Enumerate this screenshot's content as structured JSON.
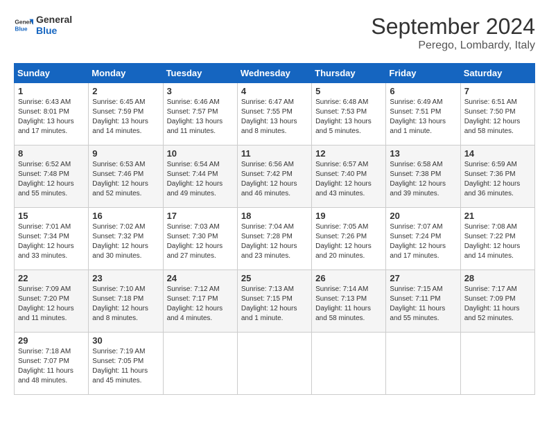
{
  "header": {
    "logo_line1": "General",
    "logo_line2": "Blue",
    "month": "September 2024",
    "location": "Perego, Lombardy, Italy"
  },
  "weekdays": [
    "Sunday",
    "Monday",
    "Tuesday",
    "Wednesday",
    "Thursday",
    "Friday",
    "Saturday"
  ],
  "weeks": [
    [
      {
        "day": "1",
        "lines": [
          "Sunrise: 6:43 AM",
          "Sunset: 8:01 PM",
          "Daylight: 13 hours",
          "and 17 minutes."
        ]
      },
      {
        "day": "2",
        "lines": [
          "Sunrise: 6:45 AM",
          "Sunset: 7:59 PM",
          "Daylight: 13 hours",
          "and 14 minutes."
        ]
      },
      {
        "day": "3",
        "lines": [
          "Sunrise: 6:46 AM",
          "Sunset: 7:57 PM",
          "Daylight: 13 hours",
          "and 11 minutes."
        ]
      },
      {
        "day": "4",
        "lines": [
          "Sunrise: 6:47 AM",
          "Sunset: 7:55 PM",
          "Daylight: 13 hours",
          "and 8 minutes."
        ]
      },
      {
        "day": "5",
        "lines": [
          "Sunrise: 6:48 AM",
          "Sunset: 7:53 PM",
          "Daylight: 13 hours",
          "and 5 minutes."
        ]
      },
      {
        "day": "6",
        "lines": [
          "Sunrise: 6:49 AM",
          "Sunset: 7:51 PM",
          "Daylight: 13 hours",
          "and 1 minute."
        ]
      },
      {
        "day": "7",
        "lines": [
          "Sunrise: 6:51 AM",
          "Sunset: 7:50 PM",
          "Daylight: 12 hours",
          "and 58 minutes."
        ]
      }
    ],
    [
      {
        "day": "8",
        "lines": [
          "Sunrise: 6:52 AM",
          "Sunset: 7:48 PM",
          "Daylight: 12 hours",
          "and 55 minutes."
        ]
      },
      {
        "day": "9",
        "lines": [
          "Sunrise: 6:53 AM",
          "Sunset: 7:46 PM",
          "Daylight: 12 hours",
          "and 52 minutes."
        ]
      },
      {
        "day": "10",
        "lines": [
          "Sunrise: 6:54 AM",
          "Sunset: 7:44 PM",
          "Daylight: 12 hours",
          "and 49 minutes."
        ]
      },
      {
        "day": "11",
        "lines": [
          "Sunrise: 6:56 AM",
          "Sunset: 7:42 PM",
          "Daylight: 12 hours",
          "and 46 minutes."
        ]
      },
      {
        "day": "12",
        "lines": [
          "Sunrise: 6:57 AM",
          "Sunset: 7:40 PM",
          "Daylight: 12 hours",
          "and 43 minutes."
        ]
      },
      {
        "day": "13",
        "lines": [
          "Sunrise: 6:58 AM",
          "Sunset: 7:38 PM",
          "Daylight: 12 hours",
          "and 39 minutes."
        ]
      },
      {
        "day": "14",
        "lines": [
          "Sunrise: 6:59 AM",
          "Sunset: 7:36 PM",
          "Daylight: 12 hours",
          "and 36 minutes."
        ]
      }
    ],
    [
      {
        "day": "15",
        "lines": [
          "Sunrise: 7:01 AM",
          "Sunset: 7:34 PM",
          "Daylight: 12 hours",
          "and 33 minutes."
        ]
      },
      {
        "day": "16",
        "lines": [
          "Sunrise: 7:02 AM",
          "Sunset: 7:32 PM",
          "Daylight: 12 hours",
          "and 30 minutes."
        ]
      },
      {
        "day": "17",
        "lines": [
          "Sunrise: 7:03 AM",
          "Sunset: 7:30 PM",
          "Daylight: 12 hours",
          "and 27 minutes."
        ]
      },
      {
        "day": "18",
        "lines": [
          "Sunrise: 7:04 AM",
          "Sunset: 7:28 PM",
          "Daylight: 12 hours",
          "and 23 minutes."
        ]
      },
      {
        "day": "19",
        "lines": [
          "Sunrise: 7:05 AM",
          "Sunset: 7:26 PM",
          "Daylight: 12 hours",
          "and 20 minutes."
        ]
      },
      {
        "day": "20",
        "lines": [
          "Sunrise: 7:07 AM",
          "Sunset: 7:24 PM",
          "Daylight: 12 hours",
          "and 17 minutes."
        ]
      },
      {
        "day": "21",
        "lines": [
          "Sunrise: 7:08 AM",
          "Sunset: 7:22 PM",
          "Daylight: 12 hours",
          "and 14 minutes."
        ]
      }
    ],
    [
      {
        "day": "22",
        "lines": [
          "Sunrise: 7:09 AM",
          "Sunset: 7:20 PM",
          "Daylight: 12 hours",
          "and 11 minutes."
        ]
      },
      {
        "day": "23",
        "lines": [
          "Sunrise: 7:10 AM",
          "Sunset: 7:18 PM",
          "Daylight: 12 hours",
          "and 8 minutes."
        ]
      },
      {
        "day": "24",
        "lines": [
          "Sunrise: 7:12 AM",
          "Sunset: 7:17 PM",
          "Daylight: 12 hours",
          "and 4 minutes."
        ]
      },
      {
        "day": "25",
        "lines": [
          "Sunrise: 7:13 AM",
          "Sunset: 7:15 PM",
          "Daylight: 12 hours",
          "and 1 minute."
        ]
      },
      {
        "day": "26",
        "lines": [
          "Sunrise: 7:14 AM",
          "Sunset: 7:13 PM",
          "Daylight: 11 hours",
          "and 58 minutes."
        ]
      },
      {
        "day": "27",
        "lines": [
          "Sunrise: 7:15 AM",
          "Sunset: 7:11 PM",
          "Daylight: 11 hours",
          "and 55 minutes."
        ]
      },
      {
        "day": "28",
        "lines": [
          "Sunrise: 7:17 AM",
          "Sunset: 7:09 PM",
          "Daylight: 11 hours",
          "and 52 minutes."
        ]
      }
    ],
    [
      {
        "day": "29",
        "lines": [
          "Sunrise: 7:18 AM",
          "Sunset: 7:07 PM",
          "Daylight: 11 hours",
          "and 48 minutes."
        ]
      },
      {
        "day": "30",
        "lines": [
          "Sunrise: 7:19 AM",
          "Sunset: 7:05 PM",
          "Daylight: 11 hours",
          "and 45 minutes."
        ]
      },
      {
        "day": "",
        "lines": []
      },
      {
        "day": "",
        "lines": []
      },
      {
        "day": "",
        "lines": []
      },
      {
        "day": "",
        "lines": []
      },
      {
        "day": "",
        "lines": []
      }
    ]
  ]
}
